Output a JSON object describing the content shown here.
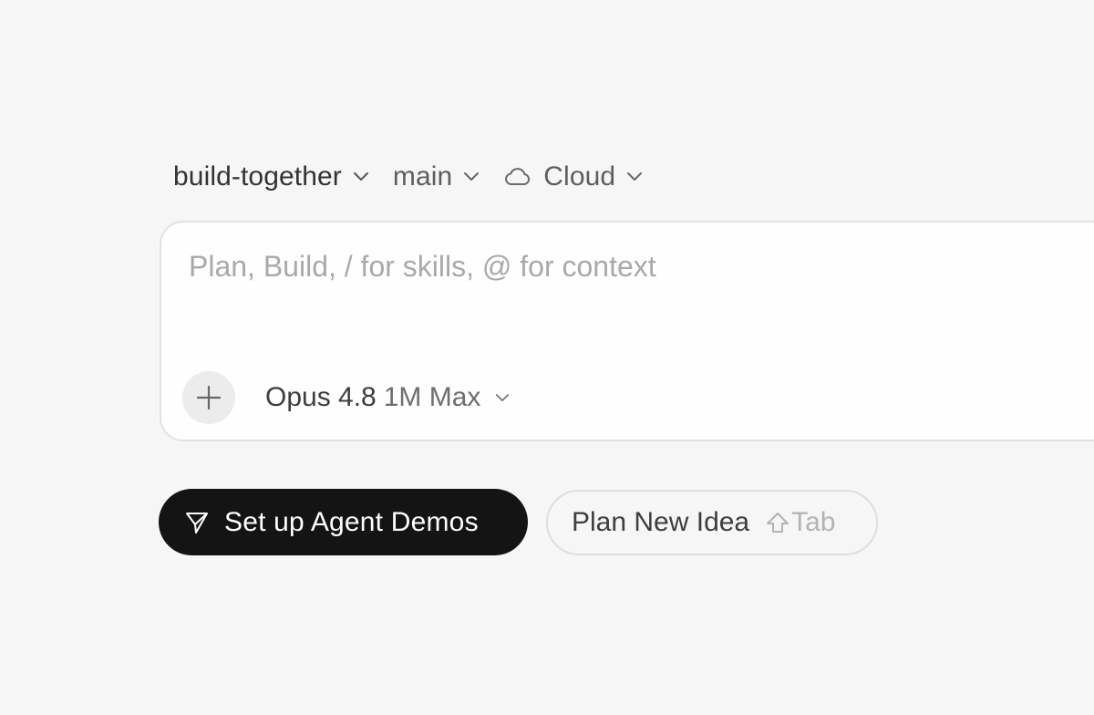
{
  "context_bar": {
    "repository": "build-together",
    "branch": "main",
    "environment": "Cloud"
  },
  "composer": {
    "value": "",
    "placeholder": "Plan, Build, / for skills, @ for context",
    "model": {
      "name": "Opus 4.8",
      "variant": "1M Max"
    }
  },
  "actions": {
    "primary": {
      "label": "Set up Agent Demos",
      "icon": "send-icon"
    },
    "secondary": {
      "label": "Plan New Idea",
      "shortcut_key": "Tab",
      "shortcut_icon": "shift-icon"
    }
  },
  "colors": {
    "background": "#f6f6f6",
    "primary_button": "#141414",
    "placeholder": "#a9a9a9"
  }
}
